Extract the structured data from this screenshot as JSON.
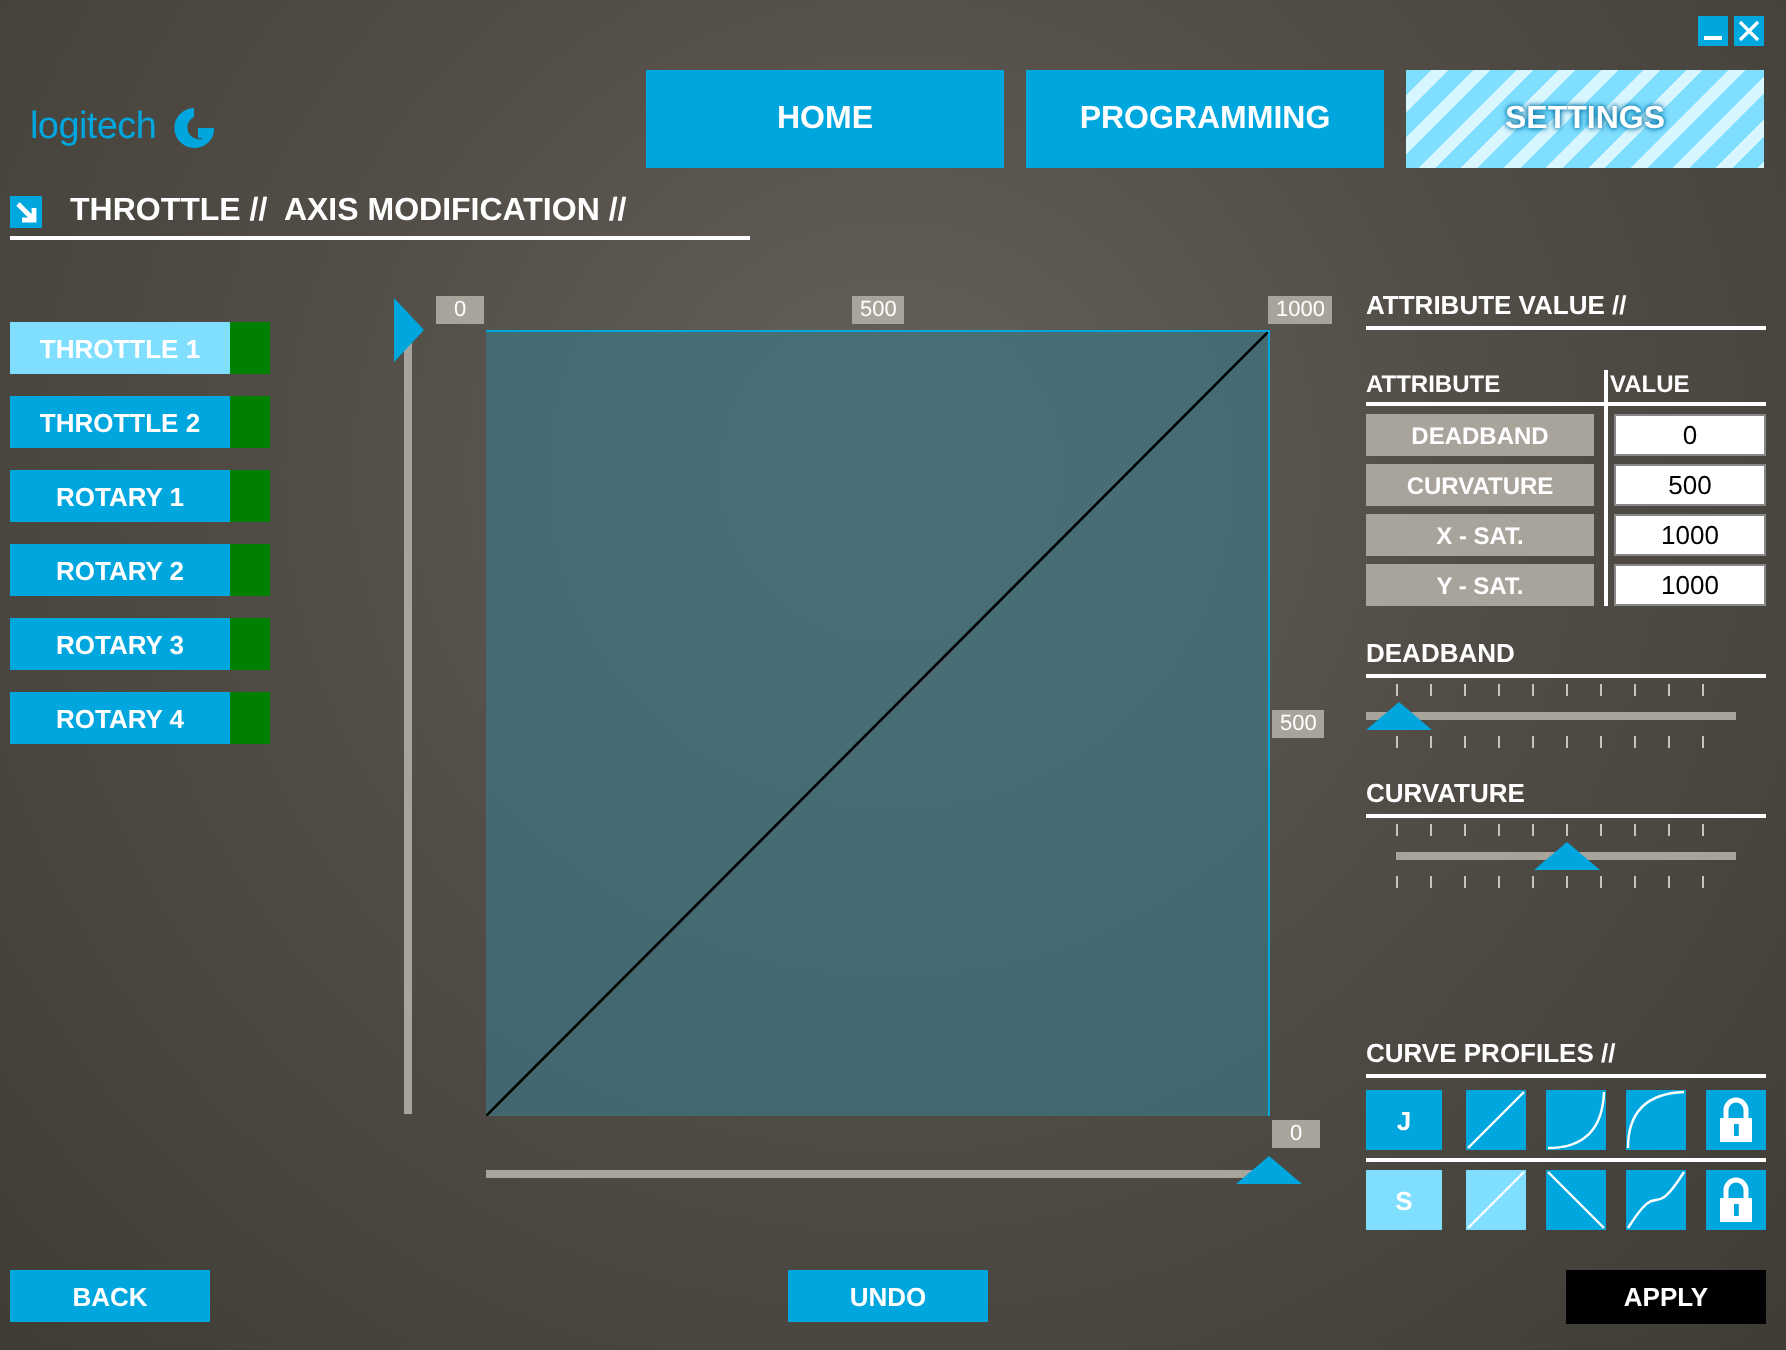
{
  "logo": {
    "wordmark": "logitech"
  },
  "nav": [
    {
      "label": "HOME",
      "selected": false
    },
    {
      "label": "PROGRAMMING",
      "selected": false
    },
    {
      "label": "SETTINGS",
      "selected": true
    }
  ],
  "page_title": "THROTTLE //  AXIS MODIFICATION //",
  "axes": [
    {
      "label": "THROTTLE 1",
      "selected": true,
      "color": "#008000"
    },
    {
      "label": "THROTTLE 2",
      "selected": false,
      "color": "#008000"
    },
    {
      "label": "ROTARY 1",
      "selected": false,
      "color": "#008000"
    },
    {
      "label": "ROTARY 2",
      "selected": false,
      "color": "#008000"
    },
    {
      "label": "ROTARY 3",
      "selected": false,
      "color": "#008000"
    },
    {
      "label": "ROTARY 4",
      "selected": false,
      "color": "#008000"
    }
  ],
  "editor": {
    "top_labels": [
      "0",
      "500",
      "1000"
    ],
    "right_label": "500",
    "bottom_label": "0",
    "y_slider": {
      "level": 1
    },
    "x_slider": {
      "level": 1
    }
  },
  "attributes": {
    "title": "ATTRIBUTE VALUE //",
    "columns": [
      "ATTRIBUTE",
      "VALUE"
    ],
    "rows": [
      {
        "name": "DEADBAND",
        "value": "0"
      },
      {
        "name": "CURVATURE",
        "value": "500"
      },
      {
        "name": "X - SAT.",
        "value": "1000"
      },
      {
        "name": "Y - SAT.",
        "value": "1000"
      }
    ]
  },
  "sliders": [
    {
      "label": "DEADBAND",
      "level": 0
    },
    {
      "label": "CURVATURE",
      "level": 0.5
    }
  ],
  "curve_profiles": {
    "title": "CURVE PROFILES //",
    "rows": [
      [
        {
          "kind": "letter",
          "label": "J",
          "selected": false
        },
        {
          "kind": "linear",
          "selected": false
        },
        {
          "kind": "convex",
          "selected": false
        },
        {
          "kind": "concave",
          "selected": false
        },
        {
          "kind": "lock",
          "selected": false
        }
      ],
      [
        {
          "kind": "letter",
          "label": "S",
          "selected": true
        },
        {
          "kind": "linear",
          "selected": true
        },
        {
          "kind": "inverse",
          "selected": false
        },
        {
          "kind": "s-curve",
          "selected": false
        },
        {
          "kind": "lock",
          "selected": false
        }
      ]
    ]
  },
  "footer": {
    "back": "BACK",
    "undo": "UNDO",
    "apply": "APPLY"
  }
}
